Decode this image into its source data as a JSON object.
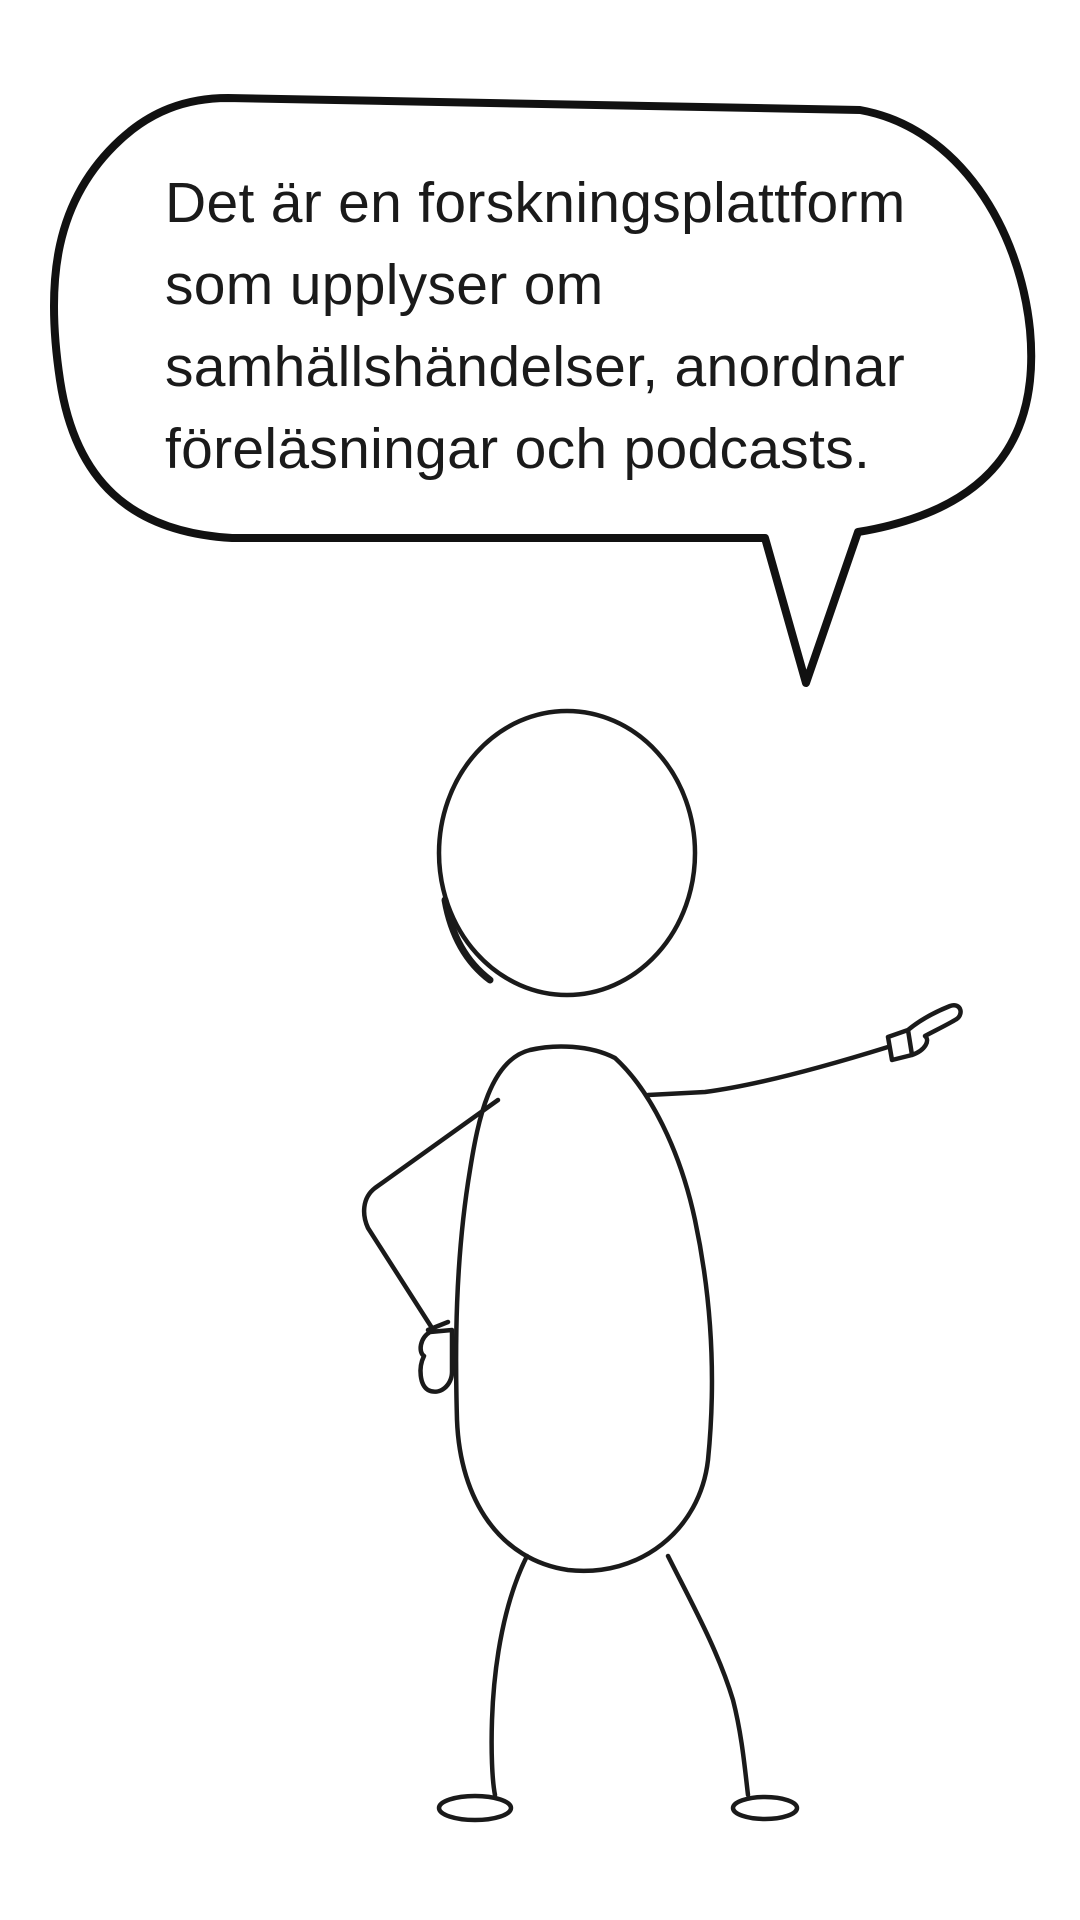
{
  "speech_bubble": {
    "lines": [
      "Det är en forskningsplattform",
      "som upplyser om",
      "samhällshändelser, anordnar",
      "föreläsningar och podcasts."
    ]
  },
  "colors": {
    "background": "#ffffff",
    "ink": "#1a1a1a"
  }
}
